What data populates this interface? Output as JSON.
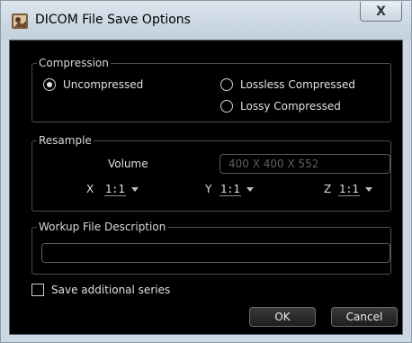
{
  "window": {
    "title": "DICOM File Save Options",
    "close_label": "X"
  },
  "compression": {
    "legend": "Compression",
    "options": [
      {
        "label": "Uncompressed",
        "selected": true
      },
      {
        "label": "Lossless Compressed",
        "selected": false
      },
      {
        "label": "Lossy Compressed",
        "selected": false
      }
    ]
  },
  "resample": {
    "legend": "Resample",
    "volume_label": "Volume",
    "volume_value": "400 X 400 X 552",
    "x_label": "X",
    "x_value": "1:1",
    "y_label": "Y",
    "y_value": "1:1",
    "z_label": "Z",
    "z_value": "1:1"
  },
  "workup": {
    "legend": "Workup File Description",
    "value": ""
  },
  "save_additional": {
    "label": "Save additional series",
    "checked": false
  },
  "buttons": {
    "ok": "OK",
    "cancel": "Cancel"
  },
  "colors": {
    "background": "#000000",
    "text": "#e0e0e0",
    "group_border": "#4e4e4e",
    "titlebar": "#cbd7e3"
  }
}
